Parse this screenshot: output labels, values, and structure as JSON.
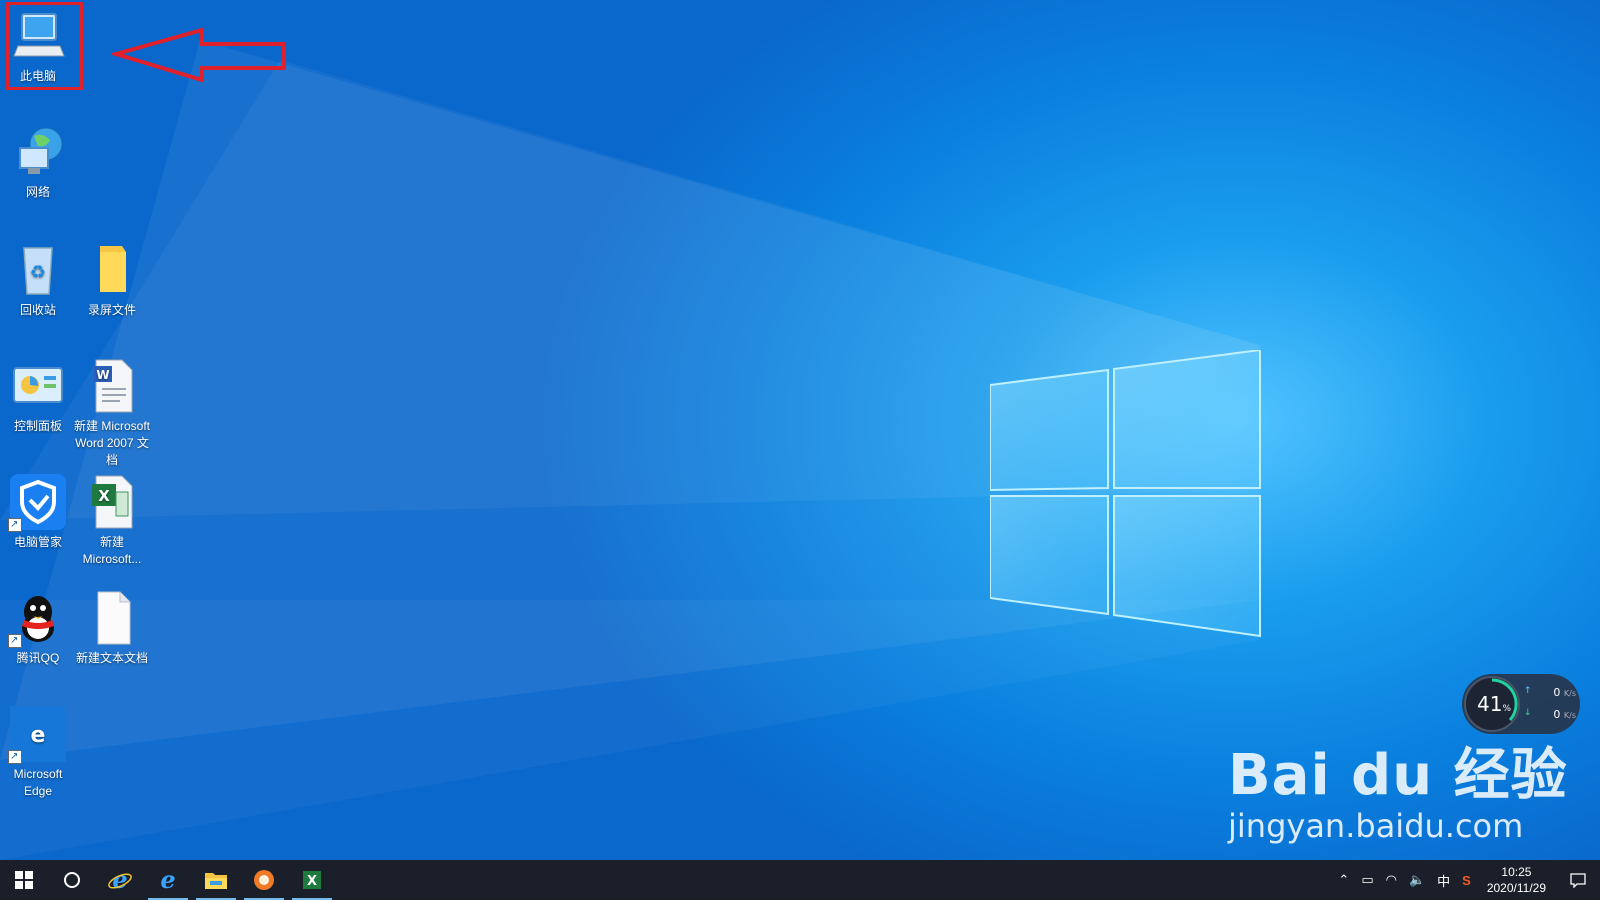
{
  "desktop": {
    "icons": [
      {
        "label": "此电脑"
      },
      {
        "label": "网络"
      },
      {
        "label": "回收站"
      },
      {
        "label": "录屏文件"
      },
      {
        "label": "控制面板"
      },
      {
        "label": "新建 Microsoft Word 2007 文档"
      },
      {
        "label": "电脑管家"
      },
      {
        "label": "新建 Microsoft..."
      },
      {
        "label": "腾讯QQ"
      },
      {
        "label": "新建文本文档"
      },
      {
        "label": "Microsoft Edge"
      }
    ]
  },
  "net_widget": {
    "cpu_percent": "41",
    "percent_sign": "%",
    "upload": "0",
    "download": "0",
    "unit": "K/s"
  },
  "watermark": {
    "brand": "Bai du 经验",
    "url": "jingyan.baidu.com"
  },
  "taskbar": {
    "apps": [
      "start-icon",
      "search-icon",
      "ie-icon",
      "ie-icon",
      "file-explorer-icon",
      "browser-icon",
      "excel-icon"
    ],
    "tray": {
      "ime": "中",
      "time": "10:25",
      "date": "2020/11/29"
    }
  },
  "colors": {
    "highlight": "#e0202a",
    "taskbar": "#1b1f2a"
  }
}
